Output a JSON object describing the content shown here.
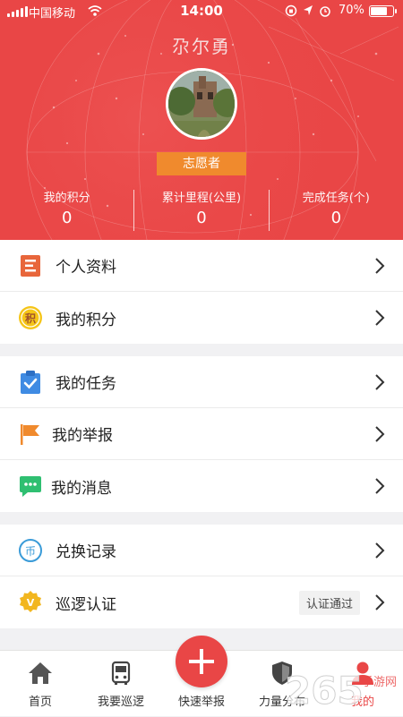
{
  "status_bar": {
    "carrier": "中国移动",
    "time": "14:00",
    "battery": "70%",
    "battery_level": 0.7
  },
  "profile": {
    "name": "尕尔勇",
    "role": "志愿者"
  },
  "stats": [
    {
      "label": "我的积分",
      "value": "0"
    },
    {
      "label": "累计里程(公里)",
      "value": "0"
    },
    {
      "label": "完成任务(个)",
      "value": "0"
    }
  ],
  "menu": {
    "group1": [
      {
        "label": "个人资料",
        "icon": "profile-doc-icon"
      },
      {
        "label": "我的积分",
        "icon": "points-coin-icon",
        "icon_text": "积"
      }
    ],
    "group2": [
      {
        "label": "我的任务",
        "icon": "task-clipboard-icon"
      },
      {
        "label": "我的举报",
        "icon": "report-flag-icon"
      },
      {
        "label": "我的消息",
        "icon": "message-bubble-icon"
      }
    ],
    "group3": [
      {
        "label": "兑换记录",
        "icon": "exchange-coin-icon",
        "icon_text": "币"
      },
      {
        "label": "巡逻认证",
        "icon": "verify-badge-icon",
        "icon_text": "V",
        "tag": "认证通过"
      }
    ]
  },
  "tabbar": {
    "tabs": [
      {
        "label": "首页",
        "icon": "home-icon"
      },
      {
        "label": "我要巡逻",
        "icon": "bus-icon"
      },
      {
        "label": "快速举报",
        "icon": "plus-icon"
      },
      {
        "label": "力量分布",
        "icon": "shield-icon"
      },
      {
        "label": "我的",
        "icon": "person-icon",
        "active": true
      }
    ]
  },
  "watermark": {
    "digits": "265",
    "text": "手游网"
  },
  "colors": {
    "brand_red": "#e94646",
    "badge_orange": "#f08a2d",
    "text": "#222222"
  }
}
